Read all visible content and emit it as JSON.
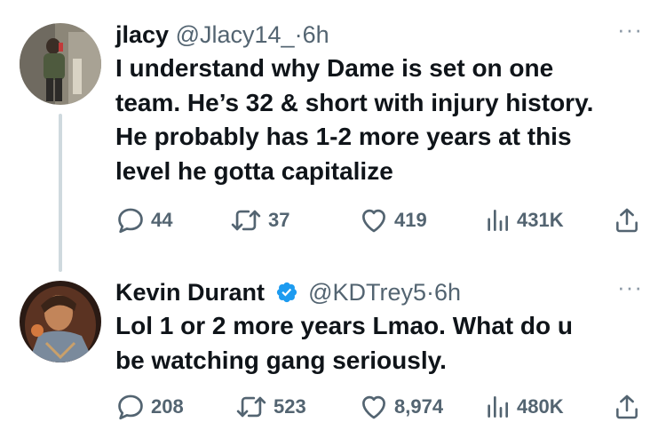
{
  "tweets": [
    {
      "name": "jlacy",
      "handle": "@Jlacy14_",
      "separator": "·",
      "time": "6h",
      "text_lines": [
        "I understand why Dame is set on one",
        "team. He’s 32 & short with injury history.",
        "He probably has 1-2 more years at this",
        "level he gotta capitalize"
      ],
      "replies": "44",
      "retweets": "37",
      "likes": "419",
      "views": "431K",
      "verified": false
    },
    {
      "name": "Kevin Durant",
      "handle": "@KDTrey5",
      "separator": "·",
      "time": "6h",
      "text_lines": [
        "Lol 1 or 2 more years Lmao. What do u",
        "be watching gang seriously."
      ],
      "replies": "208",
      "retweets": "523",
      "likes": "8,974",
      "views": "480K",
      "verified": true
    }
  ],
  "more_glyph": "···",
  "colors": {
    "text": "#0f1419",
    "secondary": "#536471",
    "verified": "#1d9bf0",
    "thread_line": "#cfd9de"
  }
}
